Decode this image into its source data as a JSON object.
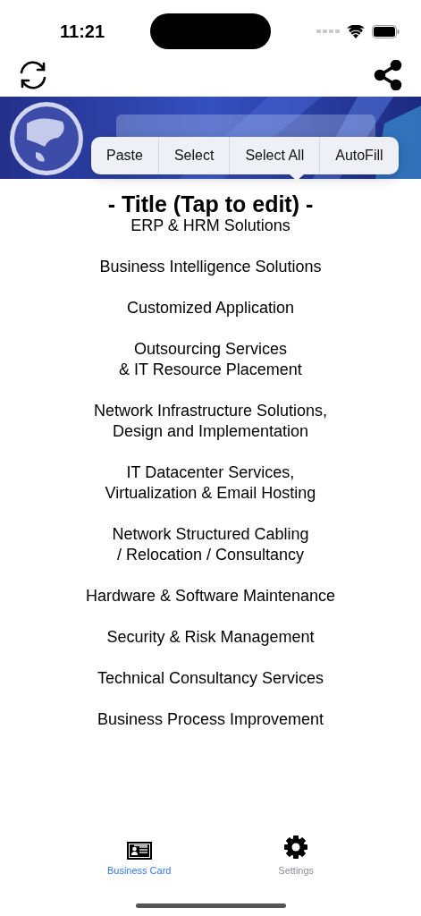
{
  "status_bar": {
    "time": "11:21"
  },
  "banner": {
    "kind": "picture"
  },
  "edit_menu": [
    "Paste",
    "Select",
    "Select All",
    "AutoFill"
  ],
  "title": "- Title (Tap to edit) -",
  "services": [
    [
      "ERP & HRM Solutions"
    ],
    [
      "Business Intelligence Solutions"
    ],
    [
      "Customized Application"
    ],
    [
      "Outsourcing Services",
      "& IT Resource Placement"
    ],
    [
      "Network Infrastructure Solutions,",
      "Design and Implementation"
    ],
    [
      "IT Datacenter Services,",
      "Virtualization & Email Hosting"
    ],
    [
      "Network Structured Cabling",
      "/ Relocation / Consultancy"
    ],
    [
      "Hardware & Software Maintenance"
    ],
    [
      "Security & Risk Management"
    ],
    [
      "Technical Consultancy Services"
    ],
    [
      "Business Process Improvement"
    ]
  ],
  "tabs": [
    {
      "label": "Business Card",
      "kind": "card",
      "selected": true
    },
    {
      "label": "Settings",
      "kind": "settings",
      "selected": false
    }
  ]
}
